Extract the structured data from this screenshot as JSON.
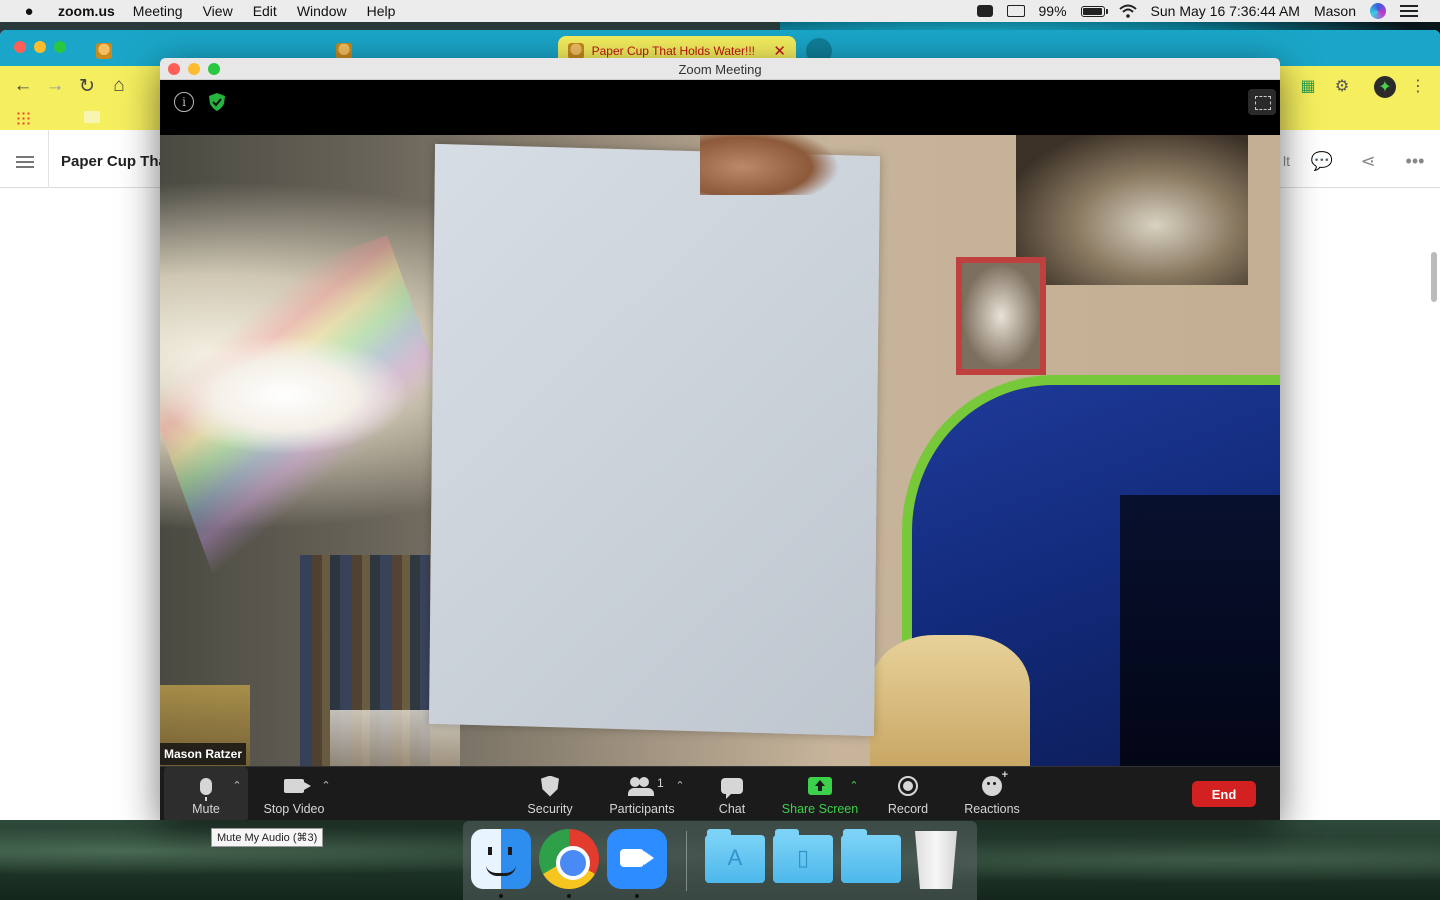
{
  "menubar": {
    "app_name": "zoom.us",
    "menus": [
      "Meeting",
      "View",
      "Edit",
      "Window",
      "Help"
    ],
    "battery": "99%",
    "datetime": "Sun May 16  7:36:44 AM",
    "user": "Mason"
  },
  "browser": {
    "active_tab_title": "Paper Cup That Holds Water!!!",
    "doc_title": "Paper Cup Tha",
    "doc_right_text": "lt"
  },
  "zoom": {
    "window_title": "Zoom Meeting",
    "participant_name": "Mason Ratzer",
    "toolbar": {
      "mute": "Mute",
      "stop_video": "Stop Video",
      "security": "Security",
      "participants": "Participants",
      "participants_count": "1",
      "chat": "Chat",
      "share_screen": "Share Screen",
      "record": "Record",
      "reactions": "Reactions",
      "end": "End"
    },
    "tooltip": "Mute My Audio (⌘3)"
  },
  "icons": {
    "accent_green": "#3bd14a",
    "end_red": "#d32020",
    "chrome_tab_bg": "#f5ef5f"
  }
}
